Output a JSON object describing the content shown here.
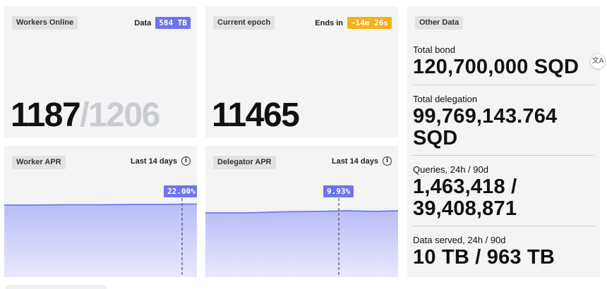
{
  "workers_online": {
    "tag": "Workers Online",
    "data_label": "Data",
    "data_value": "584 TB",
    "online": "1187",
    "separator": "/",
    "total": "1206"
  },
  "current_epoch": {
    "tag": "Current epoch",
    "ends_label": "Ends in",
    "ends_value": "~14m 26s",
    "value": "11465"
  },
  "worker_apr": {
    "tag": "Worker APR",
    "range_label": "Last 14 days",
    "value_label": "22.00%",
    "marker_fraction": 0.92
  },
  "delegator_apr": {
    "tag": "Delegator APR",
    "range_label": "Last 14 days",
    "value_label": "9.93%",
    "marker_fraction": 0.69
  },
  "other_data": {
    "tag": "Other Data",
    "total_bond_label": "Total bond",
    "total_bond_value": "120,700,000 SQD",
    "total_delegation_label": "Total delegation",
    "total_delegation_value_line1": "99,769,143.764",
    "total_delegation_value_line2": "SQD",
    "queries_label": "Queries, 24h / 90d",
    "queries_value_line1": "1,463,418 /",
    "queries_value_line2": "39,408,871",
    "data_served_label": "Data served, 24h / 90d",
    "data_served_value": "10 TB / 963 TB"
  },
  "colors": {
    "card_bg": "#f4f4f4",
    "accent_blue": "#6e74ea",
    "accent_orange": "#f4b019",
    "chart_fill_top": "#b9bcf6",
    "chart_fill_bottom": "#e8e9fd",
    "chart_line": "#7a80ee"
  },
  "icons": {
    "info": "info-circle-icon",
    "translate": "translate-icon"
  }
}
